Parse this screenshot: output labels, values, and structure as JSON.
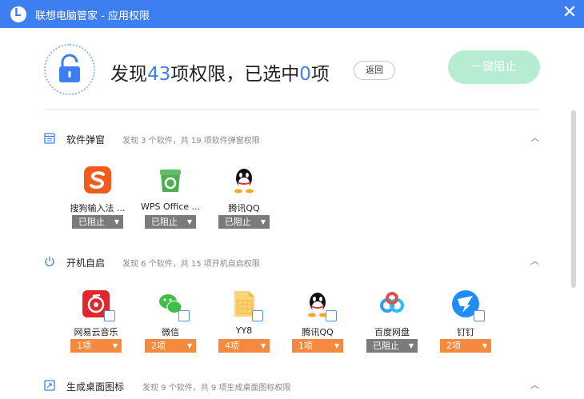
{
  "window": {
    "title": "联想电脑管家 - 应用权限",
    "logo_letter": "L"
  },
  "header": {
    "prefix": "发现",
    "total_permissions": "43",
    "middle": "项权限，已选中",
    "selected": "0",
    "suffix": "项",
    "back_label": "返回",
    "block_all_label": "一键阻止"
  },
  "sections": [
    {
      "title": "软件弹窗",
      "description": "发现 3 个软件，共 19 项软件弹窗权限",
      "apps": [
        {
          "name": "搜狗输入法 ...",
          "status": "已阻止",
          "icon": "sogou-icon"
        },
        {
          "name": "WPS Office ...",
          "status": "已阻止",
          "icon": "wps-icon"
        },
        {
          "name": "腾讯QQ",
          "status": "已阻止",
          "icon": "qq-icon"
        }
      ]
    },
    {
      "title": "开机自启",
      "description": "发现 6 个软件，共 15 项开机自启权限",
      "apps": [
        {
          "name": "网易云音乐",
          "status": "1项",
          "icon": "netease-music-icon"
        },
        {
          "name": "微信",
          "status": "2项",
          "icon": "wechat-icon"
        },
        {
          "name": "YY8",
          "status": "4项",
          "icon": "yy8-icon"
        },
        {
          "name": "腾讯QQ",
          "status": "1项",
          "icon": "qq-icon"
        },
        {
          "name": "百度网盘",
          "status": "已阻止",
          "icon": "baidu-netdisk-icon"
        },
        {
          "name": "钉钉",
          "status": "2项",
          "icon": "dingtalk-icon"
        }
      ]
    },
    {
      "title": "生成桌面图标",
      "description": "发现 9 个软件，共 9 项生成桌面图标权限"
    }
  ],
  "colors": {
    "accent": "#3d7ff0",
    "blocked": "#7b7b7b",
    "count": "#f5893e",
    "green_button": "#b6edd2"
  }
}
